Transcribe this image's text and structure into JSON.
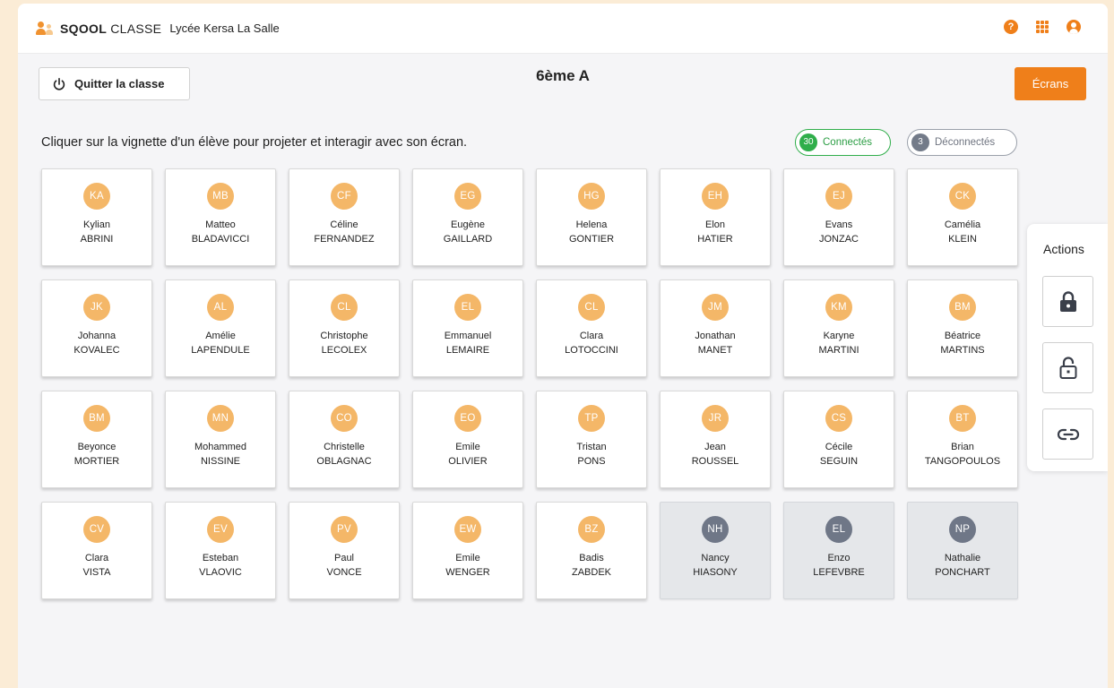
{
  "topbar": {
    "brand_bold": "SQOOL",
    "brand_light": "CLASSE",
    "school": "Lycée Kersa La Salle",
    "icons": [
      "question-icon",
      "apps-grid-icon",
      "user-account-icon"
    ]
  },
  "toolbar": {
    "quit_label": "Quitter la classe",
    "title": "6ème A",
    "screens_label": "Écrans"
  },
  "instruction": "Cliquer sur la vignette d'un élève pour projeter et interagir avec son écran.",
  "status": {
    "connected_count": "30",
    "connected_label": "Connectés",
    "disconnected_count": "3",
    "disconnected_label": "Déconnectés"
  },
  "colors": {
    "accent": "#ef7f1a",
    "avatar_connected": "#f4b768",
    "avatar_disconnected": "#6f7787",
    "connected": "#2fae4a",
    "disconnected": "#737b89"
  },
  "students": [
    {
      "initials": "KA",
      "first": "Kylian",
      "last": "ABRINI",
      "connected": true
    },
    {
      "initials": "MB",
      "first": "Matteo",
      "last": "BLADAVICCI",
      "connected": true
    },
    {
      "initials": "CF",
      "first": "Céline",
      "last": "FERNANDEZ",
      "connected": true
    },
    {
      "initials": "EG",
      "first": "Eugène",
      "last": "GAILLARD",
      "connected": true
    },
    {
      "initials": "HG",
      "first": "Helena",
      "last": "GONTIER",
      "connected": true
    },
    {
      "initials": "EH",
      "first": "Elon",
      "last": "HATIER",
      "connected": true
    },
    {
      "initials": "EJ",
      "first": "Evans",
      "last": "JONZAC",
      "connected": true
    },
    {
      "initials": "CK",
      "first": "Camélia",
      "last": "KLEIN",
      "connected": true
    },
    {
      "initials": "JK",
      "first": "Johanna",
      "last": "KOVALEC",
      "connected": true
    },
    {
      "initials": "AL",
      "first": "Amélie",
      "last": "LAPENDULE",
      "connected": true
    },
    {
      "initials": "CL",
      "first": "Christophe",
      "last": "LECOLEX",
      "connected": true
    },
    {
      "initials": "EL",
      "first": "Emmanuel",
      "last": "LEMAIRE",
      "connected": true
    },
    {
      "initials": "CL",
      "first": "Clara",
      "last": "LOTOCCINI",
      "connected": true
    },
    {
      "initials": "JM",
      "first": "Jonathan",
      "last": "MANET",
      "connected": true
    },
    {
      "initials": "KM",
      "first": "Karyne",
      "last": "MARTINI",
      "connected": true
    },
    {
      "initials": "BM",
      "first": "Béatrice",
      "last": "MARTINS",
      "connected": true
    },
    {
      "initials": "BM",
      "first": "Beyonce",
      "last": "MORTIER",
      "connected": true
    },
    {
      "initials": "MN",
      "first": "Mohammed",
      "last": "NISSINE",
      "connected": true
    },
    {
      "initials": "CO",
      "first": "Christelle",
      "last": "OBLAGNAC",
      "connected": true
    },
    {
      "initials": "EO",
      "first": "Emile",
      "last": "OLIVIER",
      "connected": true
    },
    {
      "initials": "TP",
      "first": "Tristan",
      "last": "PONS",
      "connected": true
    },
    {
      "initials": "JR",
      "first": "Jean",
      "last": "ROUSSEL",
      "connected": true
    },
    {
      "initials": "CS",
      "first": "Cécile",
      "last": "SEGUIN",
      "connected": true
    },
    {
      "initials": "BT",
      "first": "Brian",
      "last": "TANGOPOULOS",
      "connected": true
    },
    {
      "initials": "CV",
      "first": "Clara",
      "last": "VISTA",
      "connected": true
    },
    {
      "initials": "EV",
      "first": "Esteban",
      "last": "VLAOVIC",
      "connected": true
    },
    {
      "initials": "PV",
      "first": "Paul",
      "last": "VONCE",
      "connected": true
    },
    {
      "initials": "EW",
      "first": "Emile",
      "last": "WENGER",
      "connected": true
    },
    {
      "initials": "BZ",
      "first": "Badis",
      "last": "ZABDEK",
      "connected": true
    },
    {
      "initials": "NH",
      "first": "Nancy",
      "last": "HIASONY",
      "connected": false
    },
    {
      "initials": "EL",
      "first": "Enzo",
      "last": "LEFEVBRE",
      "connected": false
    },
    {
      "initials": "NP",
      "first": "Nathalie",
      "last": "PONCHART",
      "connected": false
    }
  ],
  "actions": {
    "title": "Actions",
    "buttons": [
      {
        "name": "lock-all-button",
        "icon": "lock-icon"
      },
      {
        "name": "unlock-all-button",
        "icon": "unlock-icon"
      },
      {
        "name": "share-link-button",
        "icon": "link-icon"
      }
    ]
  }
}
